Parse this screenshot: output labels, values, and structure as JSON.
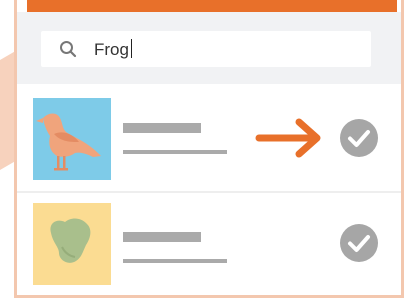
{
  "search": {
    "icon": "search-icon",
    "value": "Frog"
  },
  "results": [
    {
      "thumbnail_icon": "bird-icon",
      "thumbnail_bg": "#7ecbe8",
      "action_icon": "arrow-right-icon",
      "status_icon": "check-circle-icon",
      "highlighted": true
    },
    {
      "thumbnail_icon": "blob-icon",
      "thumbnail_bg": "#fbdc92",
      "status_icon": "check-circle-icon",
      "highlighted": false
    }
  ],
  "colors": {
    "accent": "#e8702a",
    "panel_border": "#f3c7ae",
    "search_bg": "#f1f2f4",
    "placeholder_bar": "#aaaaaa",
    "check": "#a6a6a6"
  }
}
